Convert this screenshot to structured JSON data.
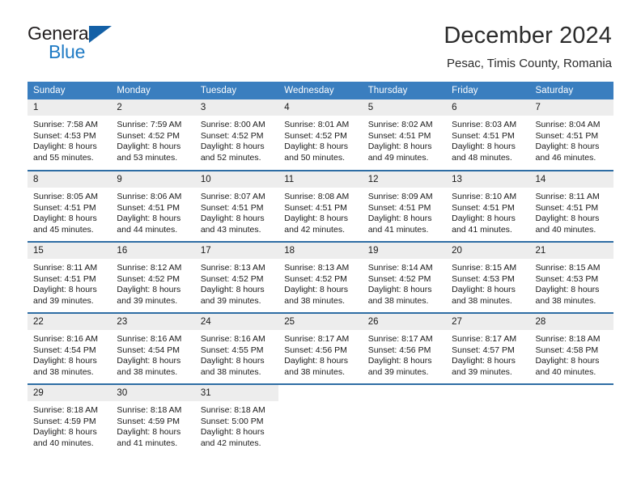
{
  "brand": {
    "name_part1": "General",
    "name_part2": "Blue",
    "logo_icon": "triangle-logo-icon"
  },
  "header": {
    "month_title": "December 2024",
    "location": "Pesac, Timis County, Romania"
  },
  "colors": {
    "header_blue": "#3a7ebf",
    "row_divider_blue": "#2e6da4",
    "daynum_background": "#ededed",
    "brand_blue": "#1e7ac4",
    "logo_blue": "#1360a6"
  },
  "calendar": {
    "weekday_headers": [
      "Sunday",
      "Monday",
      "Tuesday",
      "Wednesday",
      "Thursday",
      "Friday",
      "Saturday"
    ],
    "weeks": [
      [
        {
          "day": "1",
          "sunrise": "Sunrise: 7:58 AM",
          "sunset": "Sunset: 4:53 PM",
          "daylight_line1": "Daylight: 8 hours",
          "daylight_line2": "and 55 minutes."
        },
        {
          "day": "2",
          "sunrise": "Sunrise: 7:59 AM",
          "sunset": "Sunset: 4:52 PM",
          "daylight_line1": "Daylight: 8 hours",
          "daylight_line2": "and 53 minutes."
        },
        {
          "day": "3",
          "sunrise": "Sunrise: 8:00 AM",
          "sunset": "Sunset: 4:52 PM",
          "daylight_line1": "Daylight: 8 hours",
          "daylight_line2": "and 52 minutes."
        },
        {
          "day": "4",
          "sunrise": "Sunrise: 8:01 AM",
          "sunset": "Sunset: 4:52 PM",
          "daylight_line1": "Daylight: 8 hours",
          "daylight_line2": "and 50 minutes."
        },
        {
          "day": "5",
          "sunrise": "Sunrise: 8:02 AM",
          "sunset": "Sunset: 4:51 PM",
          "daylight_line1": "Daylight: 8 hours",
          "daylight_line2": "and 49 minutes."
        },
        {
          "day": "6",
          "sunrise": "Sunrise: 8:03 AM",
          "sunset": "Sunset: 4:51 PM",
          "daylight_line1": "Daylight: 8 hours",
          "daylight_line2": "and 48 minutes."
        },
        {
          "day": "7",
          "sunrise": "Sunrise: 8:04 AM",
          "sunset": "Sunset: 4:51 PM",
          "daylight_line1": "Daylight: 8 hours",
          "daylight_line2": "and 46 minutes."
        }
      ],
      [
        {
          "day": "8",
          "sunrise": "Sunrise: 8:05 AM",
          "sunset": "Sunset: 4:51 PM",
          "daylight_line1": "Daylight: 8 hours",
          "daylight_line2": "and 45 minutes."
        },
        {
          "day": "9",
          "sunrise": "Sunrise: 8:06 AM",
          "sunset": "Sunset: 4:51 PM",
          "daylight_line1": "Daylight: 8 hours",
          "daylight_line2": "and 44 minutes."
        },
        {
          "day": "10",
          "sunrise": "Sunrise: 8:07 AM",
          "sunset": "Sunset: 4:51 PM",
          "daylight_line1": "Daylight: 8 hours",
          "daylight_line2": "and 43 minutes."
        },
        {
          "day": "11",
          "sunrise": "Sunrise: 8:08 AM",
          "sunset": "Sunset: 4:51 PM",
          "daylight_line1": "Daylight: 8 hours",
          "daylight_line2": "and 42 minutes."
        },
        {
          "day": "12",
          "sunrise": "Sunrise: 8:09 AM",
          "sunset": "Sunset: 4:51 PM",
          "daylight_line1": "Daylight: 8 hours",
          "daylight_line2": "and 41 minutes."
        },
        {
          "day": "13",
          "sunrise": "Sunrise: 8:10 AM",
          "sunset": "Sunset: 4:51 PM",
          "daylight_line1": "Daylight: 8 hours",
          "daylight_line2": "and 41 minutes."
        },
        {
          "day": "14",
          "sunrise": "Sunrise: 8:11 AM",
          "sunset": "Sunset: 4:51 PM",
          "daylight_line1": "Daylight: 8 hours",
          "daylight_line2": "and 40 minutes."
        }
      ],
      [
        {
          "day": "15",
          "sunrise": "Sunrise: 8:11 AM",
          "sunset": "Sunset: 4:51 PM",
          "daylight_line1": "Daylight: 8 hours",
          "daylight_line2": "and 39 minutes."
        },
        {
          "day": "16",
          "sunrise": "Sunrise: 8:12 AM",
          "sunset": "Sunset: 4:52 PM",
          "daylight_line1": "Daylight: 8 hours",
          "daylight_line2": "and 39 minutes."
        },
        {
          "day": "17",
          "sunrise": "Sunrise: 8:13 AM",
          "sunset": "Sunset: 4:52 PM",
          "daylight_line1": "Daylight: 8 hours",
          "daylight_line2": "and 39 minutes."
        },
        {
          "day": "18",
          "sunrise": "Sunrise: 8:13 AM",
          "sunset": "Sunset: 4:52 PM",
          "daylight_line1": "Daylight: 8 hours",
          "daylight_line2": "and 38 minutes."
        },
        {
          "day": "19",
          "sunrise": "Sunrise: 8:14 AM",
          "sunset": "Sunset: 4:52 PM",
          "daylight_line1": "Daylight: 8 hours",
          "daylight_line2": "and 38 minutes."
        },
        {
          "day": "20",
          "sunrise": "Sunrise: 8:15 AM",
          "sunset": "Sunset: 4:53 PM",
          "daylight_line1": "Daylight: 8 hours",
          "daylight_line2": "and 38 minutes."
        },
        {
          "day": "21",
          "sunrise": "Sunrise: 8:15 AM",
          "sunset": "Sunset: 4:53 PM",
          "daylight_line1": "Daylight: 8 hours",
          "daylight_line2": "and 38 minutes."
        }
      ],
      [
        {
          "day": "22",
          "sunrise": "Sunrise: 8:16 AM",
          "sunset": "Sunset: 4:54 PM",
          "daylight_line1": "Daylight: 8 hours",
          "daylight_line2": "and 38 minutes."
        },
        {
          "day": "23",
          "sunrise": "Sunrise: 8:16 AM",
          "sunset": "Sunset: 4:54 PM",
          "daylight_line1": "Daylight: 8 hours",
          "daylight_line2": "and 38 minutes."
        },
        {
          "day": "24",
          "sunrise": "Sunrise: 8:16 AM",
          "sunset": "Sunset: 4:55 PM",
          "daylight_line1": "Daylight: 8 hours",
          "daylight_line2": "and 38 minutes."
        },
        {
          "day": "25",
          "sunrise": "Sunrise: 8:17 AM",
          "sunset": "Sunset: 4:56 PM",
          "daylight_line1": "Daylight: 8 hours",
          "daylight_line2": "and 38 minutes."
        },
        {
          "day": "26",
          "sunrise": "Sunrise: 8:17 AM",
          "sunset": "Sunset: 4:56 PM",
          "daylight_line1": "Daylight: 8 hours",
          "daylight_line2": "and 39 minutes."
        },
        {
          "day": "27",
          "sunrise": "Sunrise: 8:17 AM",
          "sunset": "Sunset: 4:57 PM",
          "daylight_line1": "Daylight: 8 hours",
          "daylight_line2": "and 39 minutes."
        },
        {
          "day": "28",
          "sunrise": "Sunrise: 8:18 AM",
          "sunset": "Sunset: 4:58 PM",
          "daylight_line1": "Daylight: 8 hours",
          "daylight_line2": "and 40 minutes."
        }
      ],
      [
        {
          "day": "29",
          "sunrise": "Sunrise: 8:18 AM",
          "sunset": "Sunset: 4:59 PM",
          "daylight_line1": "Daylight: 8 hours",
          "daylight_line2": "and 40 minutes."
        },
        {
          "day": "30",
          "sunrise": "Sunrise: 8:18 AM",
          "sunset": "Sunset: 4:59 PM",
          "daylight_line1": "Daylight: 8 hours",
          "daylight_line2": "and 41 minutes."
        },
        {
          "day": "31",
          "sunrise": "Sunrise: 8:18 AM",
          "sunset": "Sunset: 5:00 PM",
          "daylight_line1": "Daylight: 8 hours",
          "daylight_line2": "and 42 minutes."
        },
        {
          "day": "",
          "sunrise": "",
          "sunset": "",
          "daylight_line1": "",
          "daylight_line2": ""
        },
        {
          "day": "",
          "sunrise": "",
          "sunset": "",
          "daylight_line1": "",
          "daylight_line2": ""
        },
        {
          "day": "",
          "sunrise": "",
          "sunset": "",
          "daylight_line1": "",
          "daylight_line2": ""
        },
        {
          "day": "",
          "sunrise": "",
          "sunset": "",
          "daylight_line1": "",
          "daylight_line2": ""
        }
      ]
    ]
  }
}
